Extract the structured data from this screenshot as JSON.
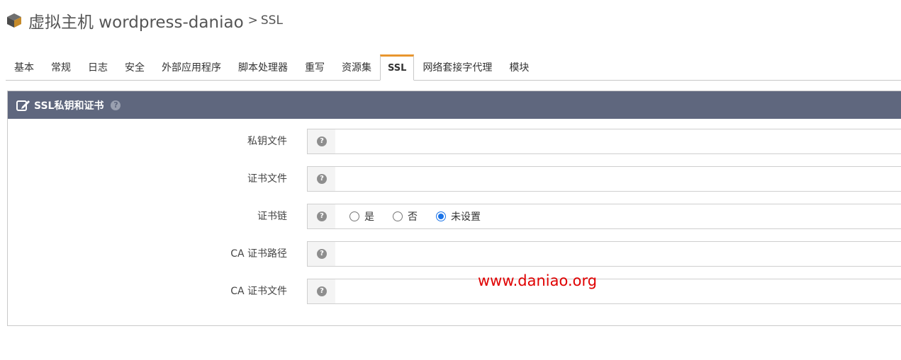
{
  "header": {
    "title": "虚拟主机 wordpress-daniao",
    "separator": ">",
    "subtitle": "SSL"
  },
  "tabs": [
    {
      "label": "基本",
      "active": false
    },
    {
      "label": "常规",
      "active": false
    },
    {
      "label": "日志",
      "active": false
    },
    {
      "label": "安全",
      "active": false
    },
    {
      "label": "外部应用程序",
      "active": false
    },
    {
      "label": "脚本处理器",
      "active": false
    },
    {
      "label": "重写",
      "active": false
    },
    {
      "label": "资源集",
      "active": false
    },
    {
      "label": "SSL",
      "active": true
    },
    {
      "label": "网络套接字代理",
      "active": false
    },
    {
      "label": "模块",
      "active": false
    }
  ],
  "panel": {
    "title": "SSL私钥和证书",
    "help_icon": "question-circle-icon",
    "accent": "#5f677e"
  },
  "fields": {
    "private_key": {
      "label": "私钥文件",
      "value": ""
    },
    "cert_file": {
      "label": "证书文件",
      "value": ""
    },
    "cert_chain": {
      "label": "证书链",
      "options": [
        "是",
        "否",
        "未设置"
      ],
      "selected": "未设置"
    },
    "ca_path": {
      "label": "CA 证书路径",
      "value": ""
    },
    "ca_file": {
      "label": "CA 证书文件",
      "value": ""
    }
  },
  "watermark": "www.daniao.org",
  "colors": {
    "tab_active_accent": "#e8962e",
    "watermark": "#e00000",
    "radio_selected": "#1a73e8"
  }
}
